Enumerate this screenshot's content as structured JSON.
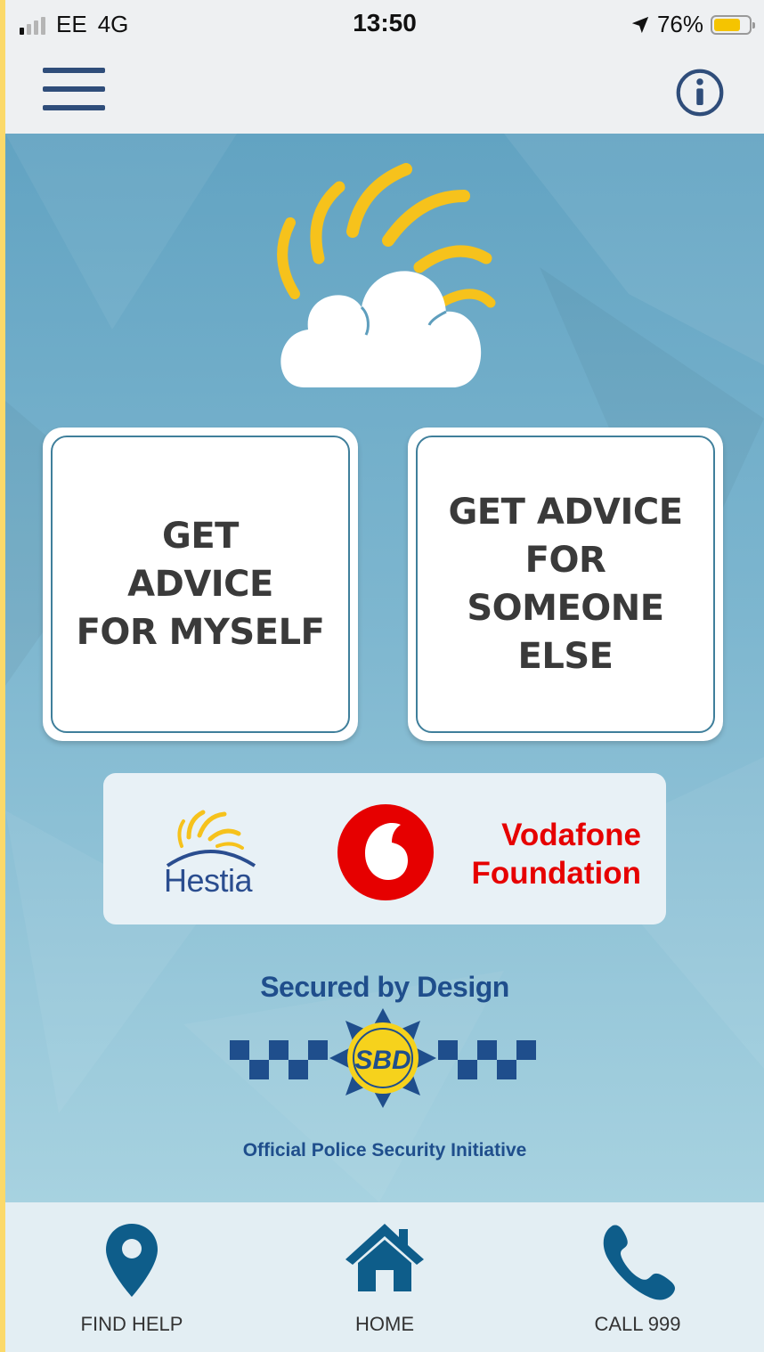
{
  "status_bar": {
    "carrier": "EE",
    "network": "4G",
    "time": "13:50",
    "battery_percent": "76%",
    "battery_level": 0.76,
    "signal_bars_active": 1,
    "signal_bars_total": 4
  },
  "header": {
    "menu_icon": "hamburger-menu-icon",
    "info_icon": "info-circle-icon"
  },
  "main": {
    "advice_myself_label": "GET\nADVICE\nFOR MYSELF",
    "advice_someone_label": "GET ADVICE\nFOR\nSOMEONE\nELSE"
  },
  "sponsors": {
    "hestia_name": "Hestia",
    "vodafone_name": "Vodafone\nFoundation"
  },
  "sbd": {
    "title": "Secured by Design",
    "badge_text": "SBD",
    "subtitle": "Official Police Security Initiative"
  },
  "bottom_nav": [
    {
      "label": "FIND HELP",
      "icon": "location-pin-icon"
    },
    {
      "label": "HOME",
      "icon": "home-icon"
    },
    {
      "label": "CALL 999",
      "icon": "phone-icon"
    }
  ],
  "colors": {
    "brand_navy": "#2f4d7a",
    "nav_icon": "#0e5d8a",
    "sun_yellow": "#f6c21c",
    "vodafone_red": "#e60000",
    "sbd_blue": "#1f4e8c"
  }
}
